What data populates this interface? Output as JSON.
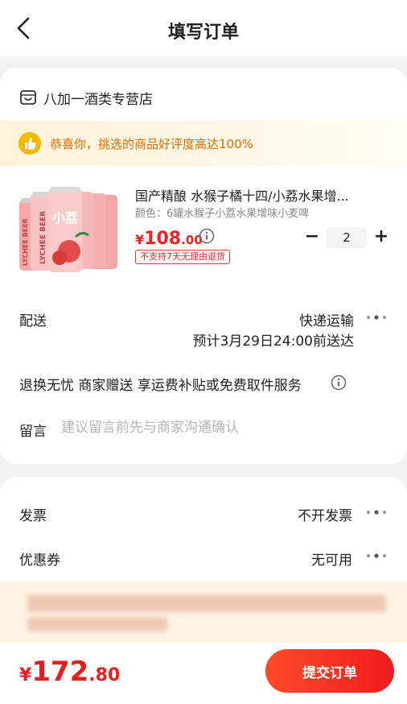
{
  "header": {
    "title": "填写订单"
  },
  "shop": {
    "name": "八加一酒类专营店"
  },
  "banner": {
    "text": "恭喜你，挑选的商品好评度高达100%"
  },
  "product": {
    "title": "国产精酿 水猴子橘十四/小荔水果增...",
    "variant": "颜色：6罐水猴子小荔水果增味小麦啤",
    "price_symbol": "¥",
    "price_int": "108",
    "price_dec": ".00",
    "tag": "不支持7天无理由退货",
    "quantity": "2",
    "image_can_text": "LYCHEE BEER",
    "image_can_cn": "小荔"
  },
  "delivery": {
    "label": "配送",
    "method": "快递运输",
    "eta": "预计3月29日24:00前送达"
  },
  "service": {
    "text": "退换无忧 商家赠送 享运费补贴或免费取件服务"
  },
  "message": {
    "label": "留言",
    "placeholder": "建议留言前先与商家沟通确认"
  },
  "invoice": {
    "label": "发票",
    "value": "不开发票"
  },
  "coupon": {
    "label": "优惠券",
    "value": "无可用"
  },
  "footer": {
    "total_symbol": "¥",
    "total_int": "172",
    "total_dec": ".80",
    "submit_label": "提交订单"
  },
  "colors": {
    "accent": "#ee1c1c",
    "banner_text": "#e26b00"
  },
  "icons": [
    "back-icon",
    "shop-icon",
    "thumbs-up-icon",
    "info-icon",
    "more-icon"
  ]
}
